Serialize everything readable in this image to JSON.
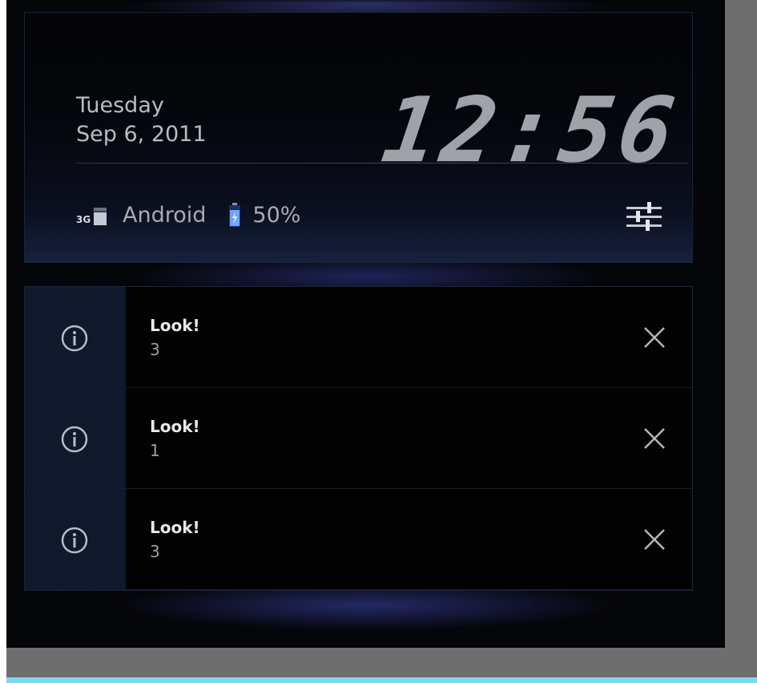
{
  "lockscreen": {
    "day": "Tuesday",
    "date": "Sep 6, 2011",
    "time": "12:56"
  },
  "status": {
    "network_type": "3G",
    "carrier": "Android",
    "battery": "50%",
    "signal_icon": "signal-3g-icon",
    "battery_icon": "battery-icon",
    "settings_icon": "sliders-settings-icon"
  },
  "notifications": [
    {
      "title": "Look!",
      "text": "3",
      "icon": "info-icon"
    },
    {
      "title": "Look!",
      "text": "1",
      "icon": "info-icon"
    },
    {
      "title": "Look!",
      "text": "3",
      "icon": "info-icon"
    }
  ],
  "colors": {
    "background": "#05060a",
    "accent_glow": "#3c46a0",
    "text_primary": "#e8e9ec",
    "text_secondary": "#9a9ea6"
  }
}
